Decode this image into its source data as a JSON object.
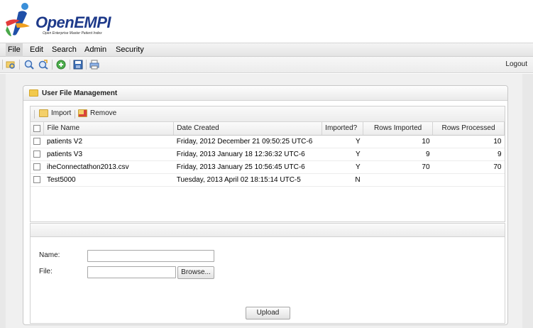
{
  "app": {
    "logo_brand": "OpenEMPI",
    "logo_tagline": "Open Enterprise Master Patient Index"
  },
  "menu": {
    "items": [
      {
        "label": "File"
      },
      {
        "label": "Edit"
      },
      {
        "label": "Search"
      },
      {
        "label": "Admin"
      },
      {
        "label": "Security"
      }
    ]
  },
  "toolbar": {
    "icons": [
      "folder-search-icon",
      "zoom-in-icon",
      "zoom-refresh-icon",
      "add-icon",
      "save-icon",
      "print-icon"
    ],
    "logout_label": "Logout"
  },
  "panel": {
    "title": "User File Management",
    "import_label": "Import",
    "remove_label": "Remove"
  },
  "grid": {
    "columns": [
      "File Name",
      "Date Created",
      "Imported?",
      "Rows Imported",
      "Rows Processed"
    ],
    "rows": [
      {
        "file_name": "patients V2",
        "date_created": "Friday, 2012 December 21 09:50:25 UTC-6",
        "imported": "Y",
        "rows_imported": "10",
        "rows_processed": "10"
      },
      {
        "file_name": "patients V3",
        "date_created": "Friday, 2013 January 18 12:36:32 UTC-6",
        "imported": "Y",
        "rows_imported": "9",
        "rows_processed": "9"
      },
      {
        "file_name": "iheConnectathon2013.csv",
        "date_created": "Friday, 2013 January 25 10:56:45 UTC-6",
        "imported": "Y",
        "rows_imported": "70",
        "rows_processed": "70"
      },
      {
        "file_name": "Test5000",
        "date_created": "Tuesday, 2013 April 02 18:15:14 UTC-5",
        "imported": "N",
        "rows_imported": "",
        "rows_processed": ""
      }
    ]
  },
  "form": {
    "name_label": "Name:",
    "name_value": "",
    "file_label": "File:",
    "file_value": "",
    "browse_label": "Browse...",
    "upload_label": "Upload"
  },
  "colors": {
    "brand_dark": "#1e3a8a",
    "brand_blue": "#1e5fbf",
    "panel_border": "#c8c8c8"
  }
}
